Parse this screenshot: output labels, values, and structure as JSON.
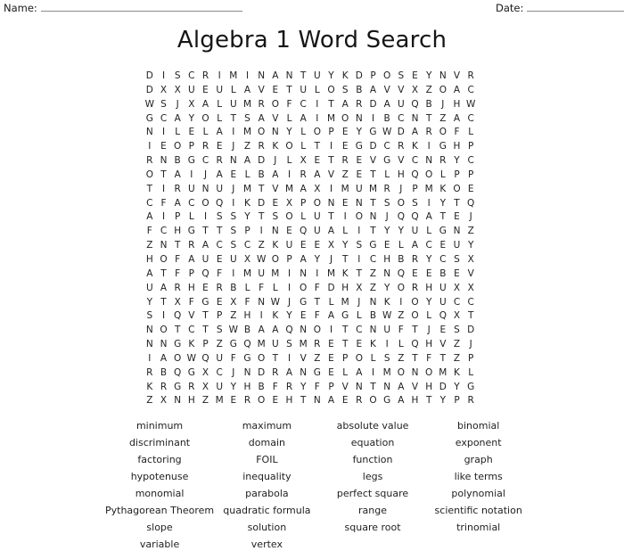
{
  "header": {
    "name_label": "Name:",
    "date_label": "Date:"
  },
  "title": "Algebra 1 Word Search",
  "grid": {
    "rows": 24,
    "cols": 24,
    "letters": [
      "D I S C R I M I N A N T U Y K D P O S E Y N V R",
      "D X X U E U L A V E T U L O S B A V V X Z O A C",
      "W S J X A L U M R O F C I T A R D A U Q B J H W",
      "G C A Y O L T S A V L A I M O N I B C N T Z A C",
      "N I L E L A I M O N Y L O P E Y G W D A R O F L",
      "I E O P R E J Z R K O L T I E G D C R K I G H P",
      "R N B G C R N A D J L X E T R E V G V C N R Y C",
      "O T A I J A E L B A I R A V Z E T L H Q O L P P",
      "T I R U N U J M T V M A X I M U M R J P M K O E",
      "C F A C O Q I K D E X P O N E N T S O S I Y T Q",
      "A I P L I S S Y T S O L U T I O N J Q Q A T E J",
      "F C H G T T S P I N E Q U A L I T Y Y U L G N Z",
      "Z N T R A C S C Z K U E E X Y S G E L A C E U Y",
      "H O F A U E U X W O P A Y J T I C H B R Y C S X",
      "A T F P Q F I M U M I N I M K T Z N Q E E B E V",
      "U A R H E R B L F L I O F D H X Z Y O R H U X X",
      "Y T X F G E X F N W J G T L M J N K I O Y U C C",
      "S I Q V T P Z H I K Y E F A G L B W Z O L Q X T",
      "N O T C T S W B A A Q N O I T C N U F T J E S D",
      "N N G K P Z G Q M U S M R E T E K I L Q H V Z J",
      "I A O W Q U F G O T I V Z E P O L S Z T F T Z P",
      "R B Q G X C J N D R A N G E L A I M O N O M K L",
      "K R G R X U Y H B F R Y F P V N T N A V H D Y G",
      "Z X N H Z M E R O E H T N A E R O G A H T Y P R"
    ]
  },
  "wordlist": {
    "columns": 4,
    "words": [
      "minimum",
      "maximum",
      "absolute value",
      "binomial",
      "discriminant",
      "domain",
      "equation",
      "exponent",
      "factoring",
      "FOIL",
      "function",
      "graph",
      "hypotenuse",
      "inequality",
      "legs",
      "like terms",
      "monomial",
      "parabola",
      "perfect square",
      "polynomial",
      "Pythagorean Theorem",
      "quadratic formula",
      "range",
      "scientific notation",
      "slope",
      "solution",
      "square root",
      "trinomial",
      "variable",
      "vertex",
      "",
      ""
    ]
  }
}
